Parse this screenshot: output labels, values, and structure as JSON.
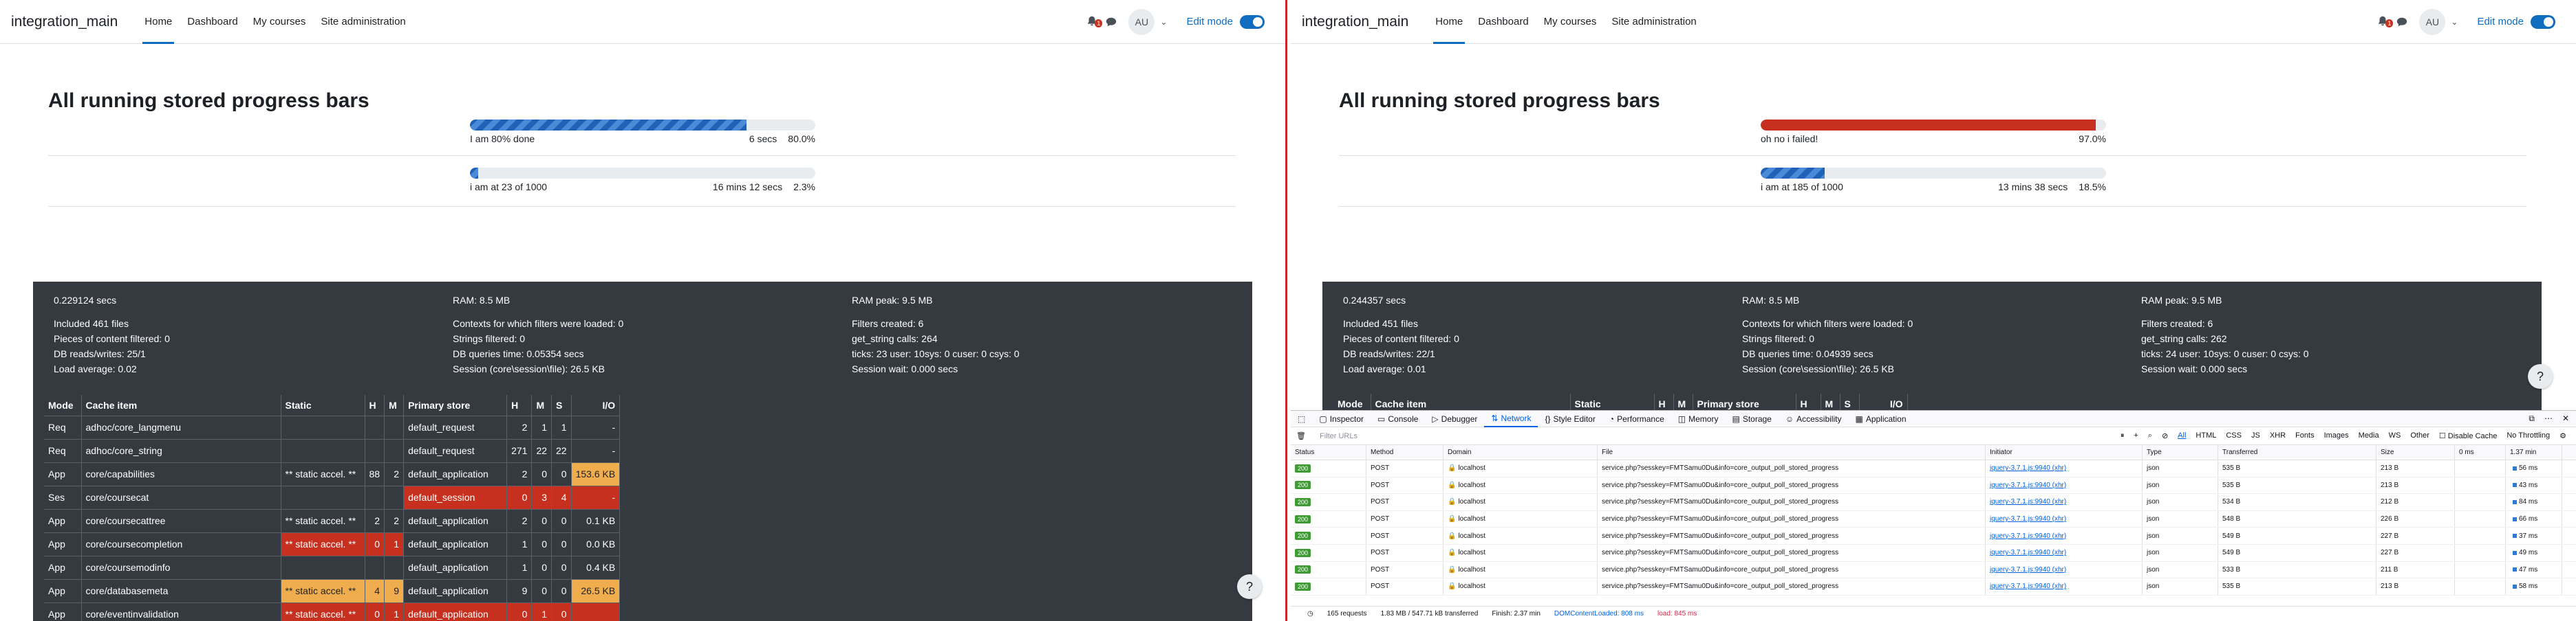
{
  "left": {
    "navbar": {
      "brand": "integration_main",
      "links": [
        "Home",
        "Dashboard",
        "My courses",
        "Site administration"
      ],
      "notif_count": "1",
      "avatar": "AU",
      "edit_mode": "Edit mode"
    },
    "title": "All running stored progress bars",
    "progress": [
      {
        "message": "I am 80% done",
        "time": "6 secs",
        "percent": "80.0%",
        "fraction": 0.8
      },
      {
        "message": "i am at 23 of 1000",
        "time": "16 mins 12 secs",
        "percent": "2.3%",
        "fraction": 0.023
      }
    ],
    "perf": {
      "col1": [
        "0.229124 secs",
        "",
        "Included 461 files",
        "Pieces of content filtered: 0",
        "DB reads/writes: 25/1",
        "Load average: 0.02"
      ],
      "col2": [
        "RAM: 8.5 MB",
        "",
        "Contexts for which filters were loaded: 0",
        "Strings filtered: 0",
        "DB queries time: 0.05354 secs",
        "Session (core\\session\\file): 26.5 KB"
      ],
      "col3": [
        "RAM peak: 9.5 MB",
        "",
        "Filters created: 6",
        "get_string calls: 264",
        "ticks: 23 user: 10sys: 0 cuser: 0 csys: 0",
        "Session wait: 0.000 secs"
      ],
      "headers": [
        "Mode",
        "Cache item",
        "Static",
        "H",
        "M",
        "Primary store",
        "H",
        "M",
        "S",
        "I/O"
      ],
      "rows": [
        [
          "Req",
          "adhoc/core_langmenu",
          "",
          "",
          "",
          "default_request",
          "2",
          "1",
          "1",
          "-"
        ],
        [
          "Req",
          "adhoc/core_string",
          "",
          "",
          "",
          "default_request",
          "271",
          "22",
          "22",
          "-"
        ],
        [
          "App",
          "core/capabilities",
          "** static accel. **",
          "88",
          "2",
          "default_application",
          "2",
          "0",
          "0",
          "153.6 KB"
        ],
        [
          "Ses",
          "core/coursecat",
          "",
          "",
          "",
          "default_session",
          "0",
          "3",
          "4",
          "-"
        ],
        [
          "App",
          "core/coursecattree",
          "** static accel. **",
          "2",
          "2",
          "default_application",
          "2",
          "0",
          "0",
          "0.1 KB"
        ],
        [
          "App",
          "core/coursecompletion",
          "** static accel. **",
          "0",
          "1",
          "default_application",
          "1",
          "0",
          "0",
          "0.0 KB"
        ],
        [
          "App",
          "core/coursemodinfo",
          "",
          "",
          "",
          "default_application",
          "1",
          "0",
          "0",
          "0.4 KB"
        ],
        [
          "App",
          "core/databasemeta",
          "** static accel. **",
          "4",
          "9",
          "default_application",
          "9",
          "0",
          "0",
          "26.5 KB"
        ],
        [
          "App",
          "core/eventinvalidation",
          "** static accel. **",
          "0",
          "1",
          "default_application",
          "0",
          "1",
          "0",
          ""
        ]
      ]
    },
    "help": "?"
  },
  "right": {
    "navbar": {
      "brand": "integration_main",
      "links": [
        "Home",
        "Dashboard",
        "My courses",
        "Site administration"
      ],
      "notif_count": "1",
      "avatar": "AU",
      "edit_mode": "Edit mode"
    },
    "title": "All running stored progress bars",
    "progress": [
      {
        "message": "oh no i failed!",
        "time": "",
        "percent": "97.0%",
        "fraction": 0.97
      },
      {
        "message": "i am at 185 of 1000",
        "time": "13 mins 38 secs",
        "percent": "18.5%",
        "fraction": 0.185
      }
    ],
    "perf": {
      "col1": [
        "0.244357 secs",
        "",
        "Included 451 files",
        "Pieces of content filtered: 0",
        "DB reads/writes: 22/1",
        "Load average: 0.01"
      ],
      "col2": [
        "RAM: 8.5 MB",
        "",
        "Contexts for which filters were loaded: 0",
        "Strings filtered: 0",
        "DB queries time: 0.04939 secs",
        "Session (core\\session\\file): 26.5 KB"
      ],
      "col3": [
        "RAM peak: 9.5 MB",
        "",
        "Filters created: 6",
        "get_string calls: 262",
        "ticks: 24 user: 10sys: 0 cuser: 0 csys: 0",
        "Session wait: 0.000 secs"
      ],
      "headers_partial": [
        "Mode",
        "Cache item",
        "Static",
        "H",
        "M",
        "Primary store",
        "H",
        "M",
        "S",
        "I/O"
      ]
    },
    "help": "?",
    "devtools": {
      "tabs": [
        "Inspector",
        "Console",
        "Debugger",
        "Network",
        "Style Editor",
        "Performance",
        "Memory",
        "Storage",
        "Accessibility",
        "Application"
      ],
      "filter_placeholder": "Filter URLs",
      "types": [
        "All",
        "HTML",
        "CSS",
        "JS",
        "XHR",
        "Fonts",
        "Images",
        "Media",
        "WS",
        "Other"
      ],
      "disable_cache": "Disable Cache",
      "throttle": "No Throttling",
      "columns": [
        "Status",
        "Method",
        "Domain",
        "File",
        "Initiator",
        "Type",
        "Transferred",
        "Size",
        "0 ms",
        "1.37 min"
      ],
      "rows": [
        {
          "status": "200",
          "method": "POST",
          "domain": "localhost",
          "file": "service.php?sesskey=FMTSamu0Du&info=core_output_poll_stored_progress",
          "initiator": "jquery-3.7.1.js:9940 (xhr)",
          "type": "json",
          "transferred": "535 B",
          "size": "213 B",
          "wf": "56 ms"
        },
        {
          "status": "200",
          "method": "POST",
          "domain": "localhost",
          "file": "service.php?sesskey=FMTSamu0Du&info=core_output_poll_stored_progress",
          "initiator": "jquery-3.7.1.js:9940 (xhr)",
          "type": "json",
          "transferred": "535 B",
          "size": "213 B",
          "wf": "43 ms"
        },
        {
          "status": "200",
          "method": "POST",
          "domain": "localhost",
          "file": "service.php?sesskey=FMTSamu0Du&info=core_output_poll_stored_progress",
          "initiator": "jquery-3.7.1.js:9940 (xhr)",
          "type": "json",
          "transferred": "534 B",
          "size": "212 B",
          "wf": "84 ms"
        },
        {
          "status": "200",
          "method": "POST",
          "domain": "localhost",
          "file": "service.php?sesskey=FMTSamu0Du&info=core_output_poll_stored_progress",
          "initiator": "jquery-3.7.1.js:9940 (xhr)",
          "type": "json",
          "transferred": "548 B",
          "size": "226 B",
          "wf": "66 ms"
        },
        {
          "status": "200",
          "method": "POST",
          "domain": "localhost",
          "file": "service.php?sesskey=FMTSamu0Du&info=core_output_poll_stored_progress",
          "initiator": "jquery-3.7.1.js:9940 (xhr)",
          "type": "json",
          "transferred": "549 B",
          "size": "227 B",
          "wf": "37 ms"
        },
        {
          "status": "200",
          "method": "POST",
          "domain": "localhost",
          "file": "service.php?sesskey=FMTSamu0Du&info=core_output_poll_stored_progress",
          "initiator": "jquery-3.7.1.js:9940 (xhr)",
          "type": "json",
          "transferred": "549 B",
          "size": "227 B",
          "wf": "49 ms"
        },
        {
          "status": "200",
          "method": "POST",
          "domain": "localhost",
          "file": "service.php?sesskey=FMTSamu0Du&info=core_output_poll_stored_progress",
          "initiator": "jquery-3.7.1.js:9940 (xhr)",
          "type": "json",
          "transferred": "533 B",
          "size": "211 B",
          "wf": "47 ms"
        },
        {
          "status": "200",
          "method": "POST",
          "domain": "localhost",
          "file": "service.php?sesskey=FMTSamu0Du&info=core_output_poll_stored_progress",
          "initiator": "jquery-3.7.1.js:9940 (xhr)",
          "type": "json",
          "transferred": "535 B",
          "size": "213 B",
          "wf": "58 ms"
        }
      ],
      "status_bar": {
        "requests": "165 requests",
        "transferred": "1.83 MB / 547.71 kB transferred",
        "finish": "Finish: 2.37 min",
        "dcl": "DOMContentLoaded: 808 ms",
        "load": "load: 845 ms"
      }
    }
  },
  "colors": {
    "accent": "#0f6cbf",
    "danger": "#c7301e",
    "warning": "#f0ad4e",
    "footer_bg": "#343a40"
  }
}
